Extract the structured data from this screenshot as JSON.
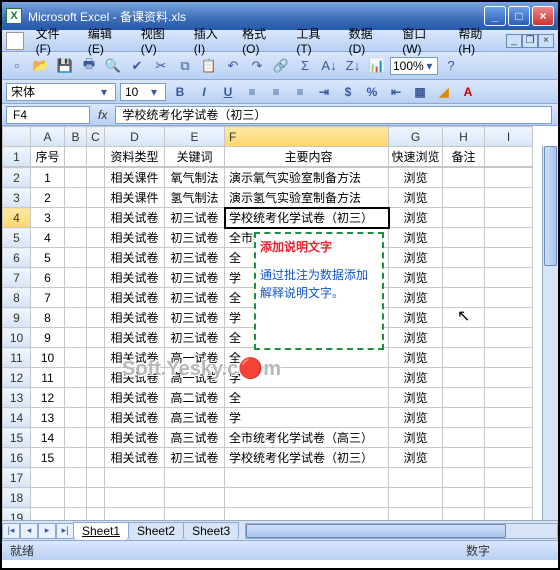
{
  "window": {
    "title": "Microsoft Excel - 备课资料.xls"
  },
  "menus": [
    "文件(F)",
    "编辑(E)",
    "视图(V)",
    "插入(I)",
    "格式(O)",
    "工具(T)",
    "数据(D)",
    "窗口(W)",
    "帮助(H)"
  ],
  "zoom": "100%",
  "font": {
    "name": "宋体",
    "size": "10"
  },
  "namebox": "F4",
  "formula": "学校统考化学试卷（初三）",
  "columns": [
    "",
    "A",
    "B",
    "C",
    "D",
    "E",
    "F",
    "G",
    "H",
    "I"
  ],
  "headers": {
    "A": "序号",
    "D": "资料类型",
    "E": "关键词",
    "F": "主要内容",
    "G": "快速浏览",
    "H": "备注"
  },
  "rows": [
    {
      "n": "1",
      "d": "相关课件",
      "e": "氧气制法",
      "f": "演示氧气实验室制备方法",
      "g": "浏览"
    },
    {
      "n": "2",
      "d": "相关课件",
      "e": "氢气制法",
      "f": "演示氢气实验室制备方法",
      "g": "浏览"
    },
    {
      "n": "3",
      "d": "相关试卷",
      "e": "初三试卷",
      "f": "学校统考化学试卷（初三）",
      "g": "浏览"
    },
    {
      "n": "4",
      "d": "相关试卷",
      "e": "初三试卷",
      "f": "全市统考化学试卷（初三）",
      "g": "浏览"
    },
    {
      "n": "5",
      "d": "相关试卷",
      "e": "初三试卷",
      "f": "全",
      "g": "浏览"
    },
    {
      "n": "6",
      "d": "相关试卷",
      "e": "初三试卷",
      "f": "学",
      "g": "浏览"
    },
    {
      "n": "7",
      "d": "相关试卷",
      "e": "初三试卷",
      "f": "全",
      "g": "浏览"
    },
    {
      "n": "8",
      "d": "相关试卷",
      "e": "初三试卷",
      "f": "学",
      "g": "浏览"
    },
    {
      "n": "9",
      "d": "相关试卷",
      "e": "初三试卷",
      "f": "全",
      "g": "浏览"
    },
    {
      "n": "10",
      "d": "相关试卷",
      "e": "高一试卷",
      "f": "全",
      "g": "浏览"
    },
    {
      "n": "11",
      "d": "相关试卷",
      "e": "高一试卷",
      "f": "学",
      "g": "浏览"
    },
    {
      "n": "12",
      "d": "相关试卷",
      "e": "高二试卷",
      "f": "全",
      "g": "浏览"
    },
    {
      "n": "13",
      "d": "相关试卷",
      "e": "高三试卷",
      "f": "学",
      "g": "浏览"
    },
    {
      "n": "14",
      "d": "相关试卷",
      "e": "高三试卷",
      "f": "全市统考化学试卷（高三）",
      "g": "浏览"
    },
    {
      "n": "15",
      "d": "相关试卷",
      "e": "初三试卷",
      "f": "学校统考化学试卷（初三）",
      "g": "浏览"
    }
  ],
  "comment": {
    "title": "添加说明文字",
    "body": "通过批注为数据添加解释说明文字。"
  },
  "watermark": "Soft.Yesky.c🔴m",
  "sheets": [
    "Sheet1",
    "Sheet2",
    "Sheet3"
  ],
  "status": {
    "left": "就绪",
    "right": "数字"
  }
}
